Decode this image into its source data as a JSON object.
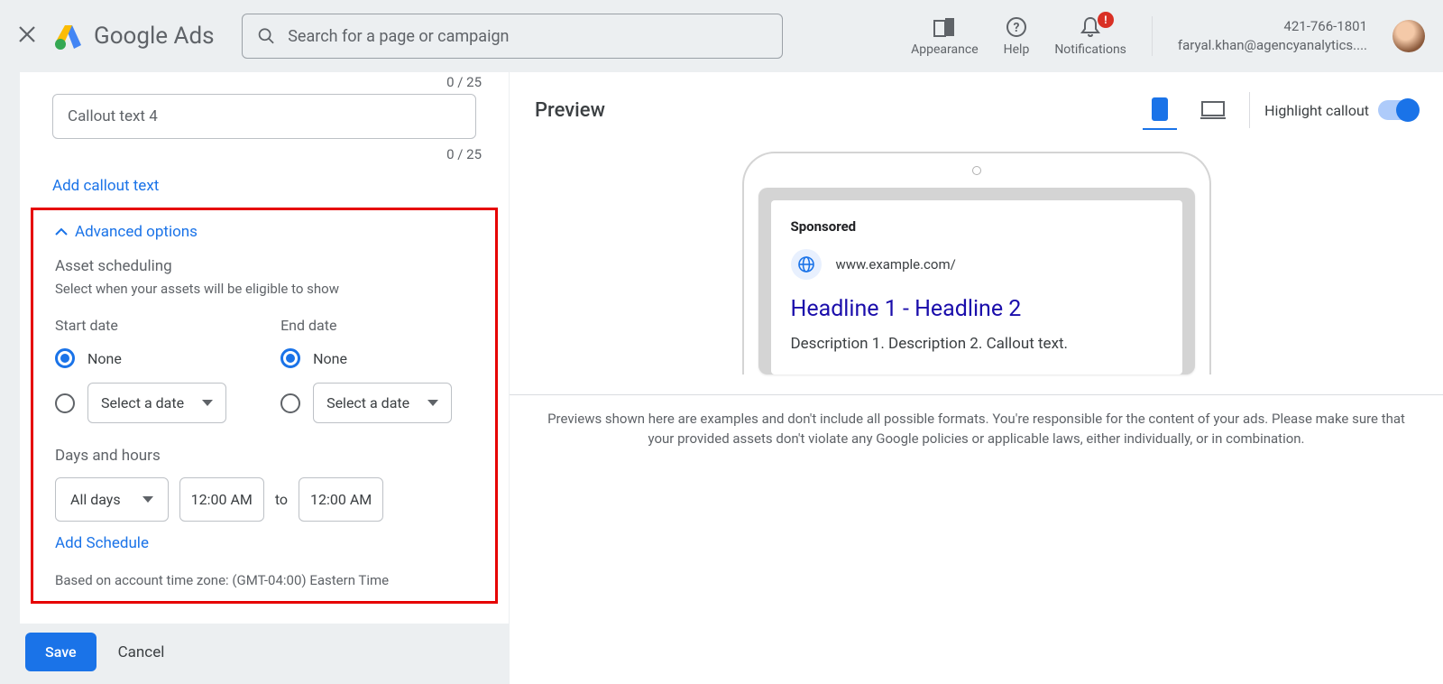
{
  "header": {
    "logo_text": "Google Ads",
    "search_placeholder": "Search for a page or campaign",
    "appearance": "Appearance",
    "help": "Help",
    "notifications": "Notifications",
    "notif_badge": "!",
    "account_phone": "421-766-1801",
    "account_email": "faryal.khan@agencyanalytics...."
  },
  "form": {
    "char_count_1": "0 / 25",
    "callout4_placeholder": "Callout text 4",
    "char_count_2": "0 / 25",
    "add_callout": "Add callout text",
    "advanced_options": "Advanced options",
    "asset_scheduling": "Asset scheduling",
    "asset_scheduling_sub": "Select when your assets will be eligible to show",
    "start_date": "Start date",
    "end_date": "End date",
    "none": "None",
    "select_date": "Select a date",
    "days_hours": "Days and hours",
    "all_days": "All days",
    "time_from": "12:00 AM",
    "to": "to",
    "time_to": "12:00 AM",
    "add_schedule": "Add Schedule",
    "tz_note": "Based on account time zone: (GMT-04:00) Eastern Time"
  },
  "footer": {
    "save": "Save",
    "cancel": "Cancel"
  },
  "preview": {
    "title": "Preview",
    "highlight_callout": "Highlight callout",
    "sponsored": "Sponsored",
    "url": "www.example.com/",
    "headline": "Headline 1 - Headline 2",
    "description": "Description 1. Description 2. Callout text.",
    "disclaimer": "Previews shown here are examples and don't include all possible formats. You're responsible for the content of your ads. Please make sure that your provided assets don't violate any Google policies or applicable laws, either individually, or in combination."
  }
}
